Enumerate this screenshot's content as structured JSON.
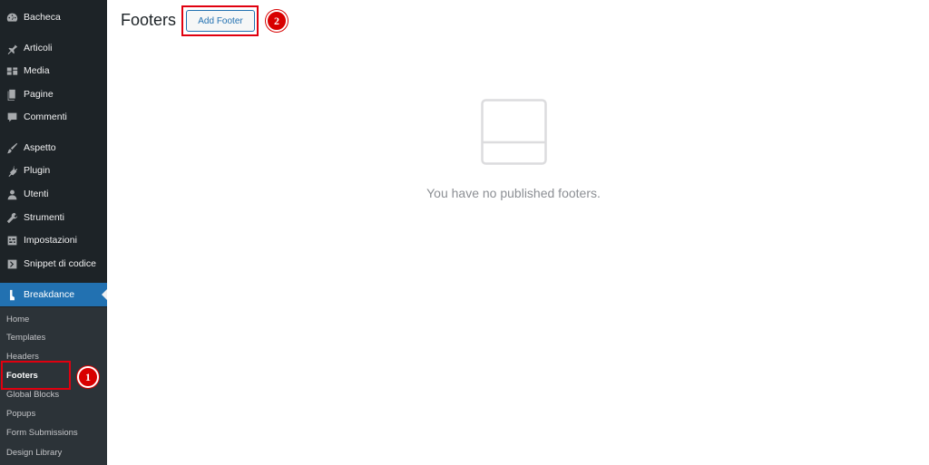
{
  "sidebar": {
    "items": [
      {
        "label": "Bacheca",
        "icon": "dashboard-icon"
      },
      {
        "label": "Articoli",
        "icon": "pin-icon"
      },
      {
        "label": "Media",
        "icon": "media-icon"
      },
      {
        "label": "Pagine",
        "icon": "pages-icon"
      },
      {
        "label": "Commenti",
        "icon": "comments-icon"
      },
      {
        "label": "Aspetto",
        "icon": "brush-icon"
      },
      {
        "label": "Plugin",
        "icon": "plugin-icon"
      },
      {
        "label": "Utenti",
        "icon": "users-icon"
      },
      {
        "label": "Strumenti",
        "icon": "wrench-icon"
      },
      {
        "label": "Impostazioni",
        "icon": "settings-icon"
      },
      {
        "label": "Snippet di codice",
        "icon": "code-icon"
      },
      {
        "label": "Breakdance",
        "icon": "breakdance-icon"
      }
    ],
    "submenu": [
      {
        "label": "Home"
      },
      {
        "label": "Templates"
      },
      {
        "label": "Headers"
      },
      {
        "label": "Footers"
      },
      {
        "label": "Global Blocks"
      },
      {
        "label": "Popups"
      },
      {
        "label": "Form Submissions"
      },
      {
        "label": "Design Library"
      }
    ]
  },
  "main": {
    "title": "Footers",
    "add_button": "Add Footer",
    "empty_message": "You have no published footers."
  },
  "annotations": {
    "badge1": "1",
    "badge2": "2"
  },
  "colors": {
    "sidebar_bg": "#1d2327",
    "submenu_bg": "#2c3338",
    "accent": "#2271b1",
    "highlight": "#e0000f"
  }
}
